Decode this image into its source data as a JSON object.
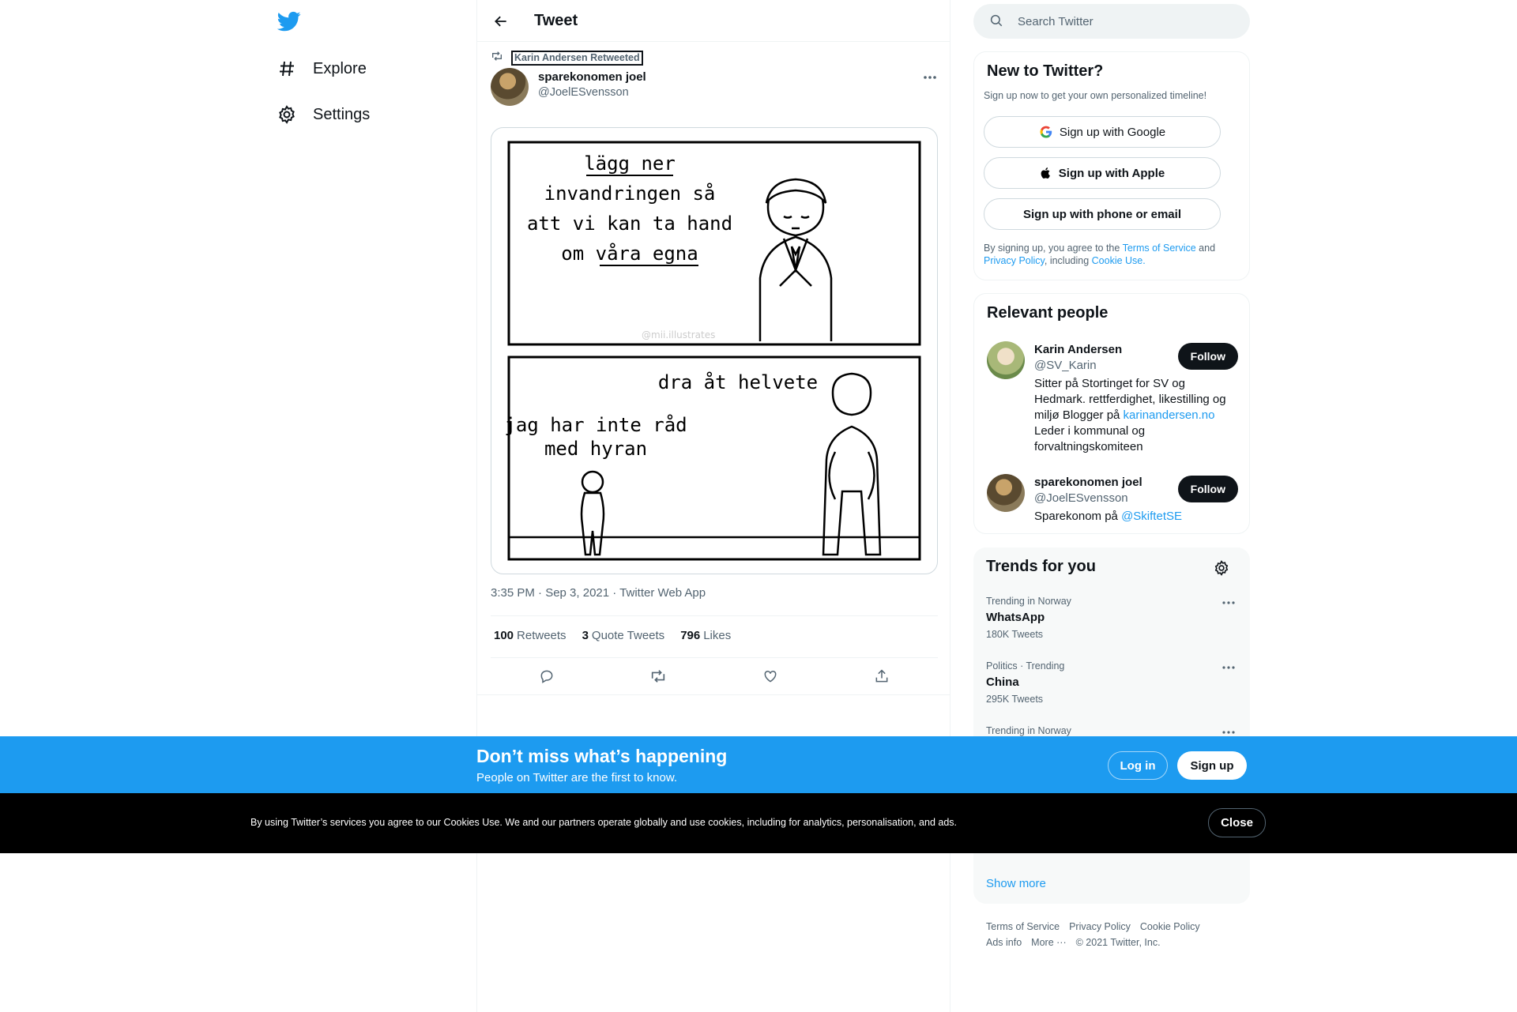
{
  "nav": {
    "logo_icon": "twitter-bird-icon",
    "items": [
      {
        "label": "Explore",
        "icon": "hashtag-icon"
      },
      {
        "label": "Settings",
        "icon": "gear-icon"
      }
    ]
  },
  "header": {
    "title": "Tweet"
  },
  "tweet": {
    "retweeted_by": "Karin Andersen Retweeted",
    "author_name": "sparekonomen joel",
    "author_handle": "@JoelESvensson",
    "comic": {
      "panel1_lines": [
        "lägg ner",
        "invandringen så",
        "att vi kan ta hand",
        "om våra egna"
      ],
      "watermark": "@mii.illustrates",
      "panel2_right": "dra åt helvete",
      "panel2_left_lines": [
        "jag har inte råd",
        "med hyran"
      ]
    },
    "meta": "3:35 PM · Sep 3, 2021 · Twitter Web App",
    "stats": [
      {
        "value": "100",
        "label": "Retweets"
      },
      {
        "value": "3",
        "label": "Quote Tweets"
      },
      {
        "value": "796",
        "label": "Likes"
      }
    ]
  },
  "search": {
    "placeholder": "Search Twitter"
  },
  "new_to_twitter": {
    "title": "New to Twitter?",
    "subtitle": "Sign up now to get your own personalized timeline!",
    "google": "Sign up with Google",
    "apple": "Sign up with Apple",
    "phone": "Sign up with phone or email",
    "legal_pre": "By signing up, you agree to the ",
    "tos": "Terms of Service",
    "and": " and ",
    "privacy": "Privacy Policy",
    "including": ", including ",
    "cookie": "Cookie Use."
  },
  "relevant_people": {
    "title": "Relevant people",
    "follow_label": "Follow",
    "people": [
      {
        "name": "Karin Andersen",
        "handle": "@SV_Karin",
        "bio_pre": "Sitter på Stortinget for SV og Hedmark. rettferdighet, likestilling og miljø Blogger på ",
        "bio_link": "karinandersen.no",
        "bio_post": " Leder i kommunal og forvaltningskomiteen"
      },
      {
        "name": "sparekonomen joel",
        "handle": "@JoelESvensson",
        "bio_pre": "Sparekonom på ",
        "bio_link": "@SkiftetSE",
        "bio_post": ""
      }
    ]
  },
  "trends": {
    "title": "Trends for you",
    "items": [
      {
        "context": "Trending in Norway",
        "name": "WhatsApp",
        "count": "180K Tweets"
      },
      {
        "context": "Politics · Trending",
        "name": "China",
        "count": "295K Tweets"
      },
      {
        "context": "Trending in Norway",
        "name": "",
        "count": ""
      }
    ],
    "show_more": "Show more"
  },
  "footer": {
    "links": [
      "Terms of Service",
      "Privacy Policy",
      "Cookie Policy",
      "Ads info",
      "More ···",
      "© 2021 Twitter, Inc."
    ]
  },
  "banner": {
    "title": "Don’t miss what’s happening",
    "subtitle": "People on Twitter are the first to know.",
    "login": "Log in",
    "signup": "Sign up"
  },
  "cookie_bar": {
    "text": "By using Twitter’s services you agree to our Cookies Use. We and our partners operate globally and use cookies, including for analytics, personalisation, and ads.",
    "close": "Close"
  },
  "colors": {
    "accent": "#1d9bf0",
    "text": "#0f1419",
    "muted": "#536471"
  }
}
